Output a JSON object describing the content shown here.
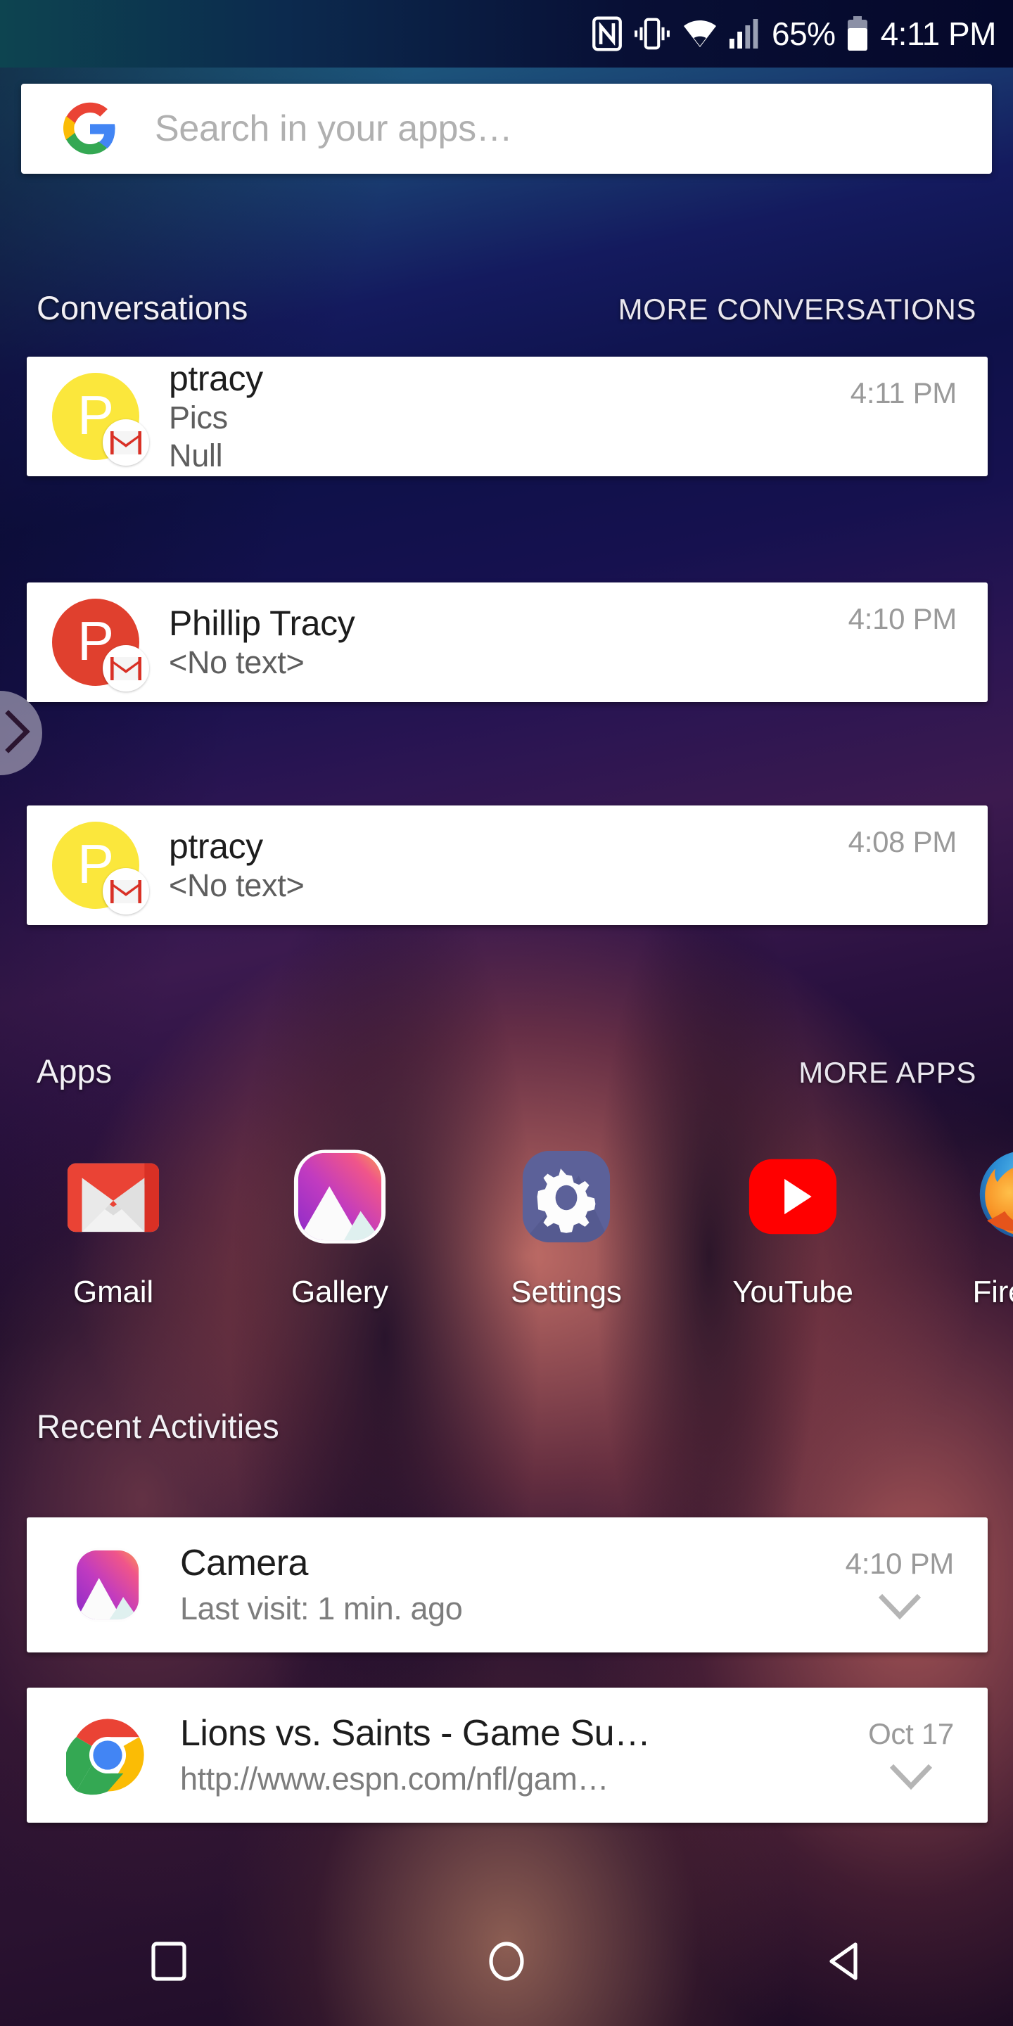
{
  "statusbar": {
    "icons": [
      "nfc-icon",
      "vibrate-icon",
      "wifi-icon",
      "signal-icon",
      "battery-icon"
    ],
    "battery_percent": "65%",
    "clock": "4:11 PM"
  },
  "search": {
    "logo": "google-g-logo",
    "placeholder": "Search in your apps…",
    "value": ""
  },
  "conversations": {
    "title": "Conversations",
    "more_label": "MORE CONVERSATIONS",
    "items": [
      {
        "initial": "P",
        "avatar_color": "#FBE73C",
        "badge": "gmail-icon",
        "name": "ptracy",
        "line1": "Pics",
        "line2": "Null",
        "time": "4:11 PM"
      },
      {
        "initial": "P",
        "avatar_color": "#E0402E",
        "badge": "gmail-icon",
        "name": "Phillip Tracy",
        "line1": "<No text>",
        "line2": "",
        "time": "4:10 PM"
      },
      {
        "initial": "P",
        "avatar_color": "#FBE73C",
        "badge": "gmail-icon",
        "name": "ptracy",
        "line1": "<No text>",
        "line2": "",
        "time": "4:08 PM"
      }
    ]
  },
  "apps": {
    "title": "Apps",
    "more_label": "MORE APPS",
    "items": [
      {
        "label": "Gmail",
        "icon": "gmail-icon"
      },
      {
        "label": "Gallery",
        "icon": "gallery-icon"
      },
      {
        "label": "Settings",
        "icon": "settings-gear-icon"
      },
      {
        "label": "YouTube",
        "icon": "youtube-icon"
      },
      {
        "label": "Firefox",
        "icon": "firefox-icon"
      }
    ]
  },
  "recent_activities": {
    "title": "Recent Activities",
    "items": [
      {
        "icon": "gallery-icon",
        "title": "Camera",
        "subtitle": "Last visit: 1 min. ago",
        "time": "4:10 PM",
        "expand": "chevron-down-icon"
      },
      {
        "icon": "chrome-icon",
        "title": "Lions vs. Saints - Game Su…",
        "subtitle": "http://www.espn.com/nfl/gam…",
        "time": "Oct 17",
        "expand": "chevron-down-icon"
      }
    ]
  },
  "drawer_handle": {
    "icon": "chevron-right-icon"
  },
  "navbar": {
    "buttons": [
      {
        "name": "recents-button",
        "icon": "square-icon"
      },
      {
        "name": "home-button",
        "icon": "circle-icon"
      },
      {
        "name": "back-button",
        "icon": "triangle-left-icon"
      }
    ]
  },
  "colors": {
    "card_bg": "#ffffff",
    "accent_yellow": "#FBE73C",
    "accent_red": "#E0402E",
    "gmail_red": "#D93025",
    "youtube_red": "#FF0000",
    "settings_blue": "#5C6199"
  }
}
